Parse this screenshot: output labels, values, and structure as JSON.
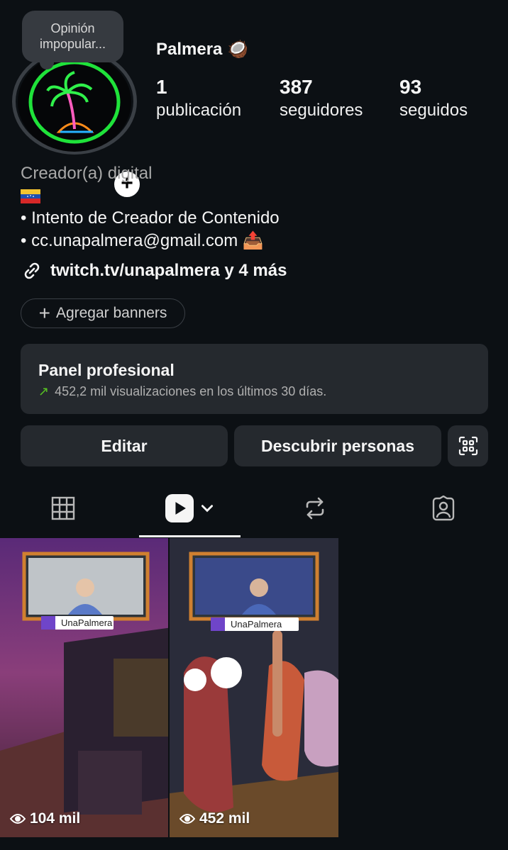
{
  "profile": {
    "note": "Opinión impopular...",
    "name": "Palmera",
    "name_emoji": "🥥",
    "stats": [
      {
        "value": "1",
        "label": "publicación"
      },
      {
        "value": "387",
        "label": "seguidores"
      },
      {
        "value": "93",
        "label": "seguidos"
      }
    ]
  },
  "bio": {
    "category": "Creador(a) digital",
    "line1": "• Intento de Creador de Contenido",
    "line2": "• cc.unapalmera@gmail.com",
    "line2_emoji": "📤",
    "link": "twitch.tv/unapalmera y 4 más"
  },
  "banner_button": "Agregar banners",
  "panel": {
    "title": "Panel profesional",
    "subtitle": "452,2 mil visualizaciones en los últimos 30 días."
  },
  "buttons": {
    "edit": "Editar",
    "discover": "Descubrir personas"
  },
  "tabs": [
    {
      "icon": "grid-icon"
    },
    {
      "icon": "reels-icon",
      "active": true
    },
    {
      "icon": "reposts-icon"
    },
    {
      "icon": "tagged-icon"
    }
  ],
  "posts": [
    {
      "views": "104 mil",
      "cam_label": "UnaPalmera"
    },
    {
      "views": "452 mil",
      "cam_label": "UnaPalmera"
    }
  ],
  "colors": {
    "background": "#0c1014",
    "card": "#25292e",
    "trend_green": "#58c322",
    "twitch_purple": "#6f45c9"
  }
}
